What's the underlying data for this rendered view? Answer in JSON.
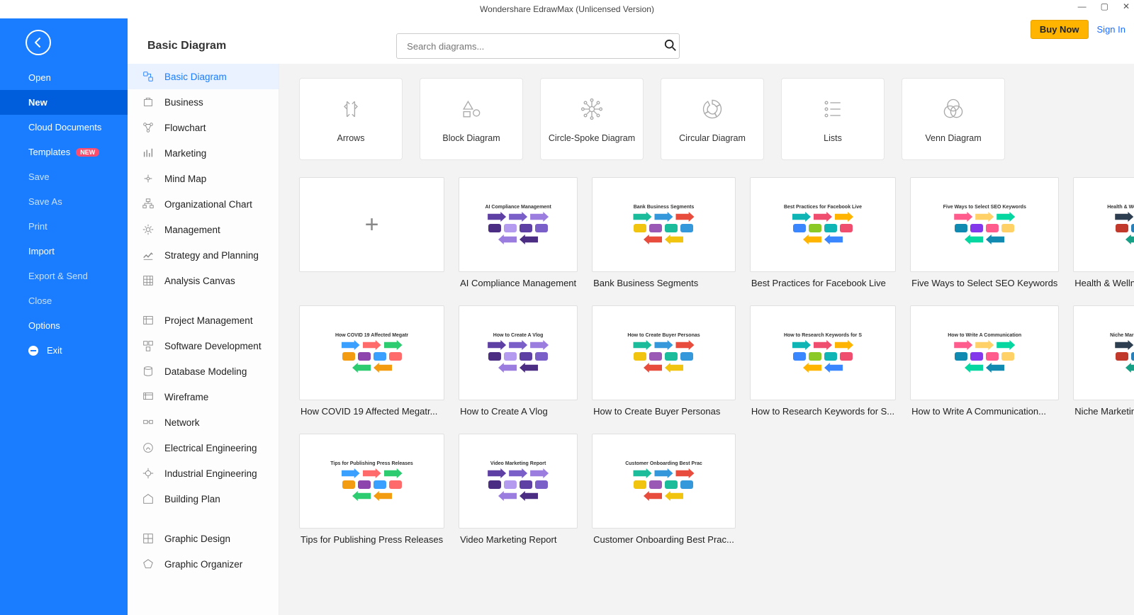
{
  "titlebar": {
    "title": "Wondershare EdrawMax (Unlicensed Version)"
  },
  "header": {
    "buy": "Buy Now",
    "signin": "Sign In"
  },
  "sidebarLeft": {
    "open": "Open",
    "new": "New",
    "cloud": "Cloud Documents",
    "templates": "Templates",
    "templates_badge": "NEW",
    "save": "Save",
    "saveas": "Save As",
    "print": "Print",
    "import": "Import",
    "export": "Export & Send",
    "close": "Close",
    "options": "Options",
    "exit": "Exit"
  },
  "pageTitle": "Basic Diagram",
  "search": {
    "placeholder": "Search diagrams..."
  },
  "categories": [
    {
      "label": "Basic Diagram",
      "active": true
    },
    {
      "label": "Business"
    },
    {
      "label": "Flowchart"
    },
    {
      "label": "Marketing"
    },
    {
      "label": "Mind Map"
    },
    {
      "label": "Organizational Chart"
    },
    {
      "label": "Management"
    },
    {
      "label": "Strategy and Planning"
    },
    {
      "label": "Analysis Canvas"
    },
    {
      "sep": true
    },
    {
      "label": "Project Management"
    },
    {
      "label": "Software Development"
    },
    {
      "label": "Database Modeling"
    },
    {
      "label": "Wireframe"
    },
    {
      "label": "Network"
    },
    {
      "label": "Electrical Engineering"
    },
    {
      "label": "Industrial Engineering"
    },
    {
      "label": "Building Plan"
    },
    {
      "sep": true
    },
    {
      "label": "Graphic Design"
    },
    {
      "label": "Graphic Organizer"
    }
  ],
  "diagramTypes": [
    {
      "label": "Arrows"
    },
    {
      "label": "Block Diagram"
    },
    {
      "label": "Circle-Spoke Diagram"
    },
    {
      "label": "Circular Diagram"
    },
    {
      "label": "Lists"
    },
    {
      "label": "Venn Diagram"
    }
  ],
  "templates": [
    {
      "title": "",
      "blank": true
    },
    {
      "title": "AI Compliance Management"
    },
    {
      "title": "Bank Business Segments"
    },
    {
      "title": "Best Practices for Facebook Live"
    },
    {
      "title": "Five Ways to Select SEO Keywords"
    },
    {
      "title": "Health & Wellness Progress Rep..."
    },
    {
      "title": "How COVID 19 Affected Megatr..."
    },
    {
      "title": "How to Create A Vlog"
    },
    {
      "title": "How to Create Buyer Personas"
    },
    {
      "title": "How to Research Keywords for S..."
    },
    {
      "title": "How to Write A Communication..."
    },
    {
      "title": "Niche Marketing Strategy Tips"
    },
    {
      "title": "Tips for Publishing Press Releases"
    },
    {
      "title": "Video Marketing Report"
    },
    {
      "title": "Customer Onboarding Best Prac..."
    }
  ]
}
